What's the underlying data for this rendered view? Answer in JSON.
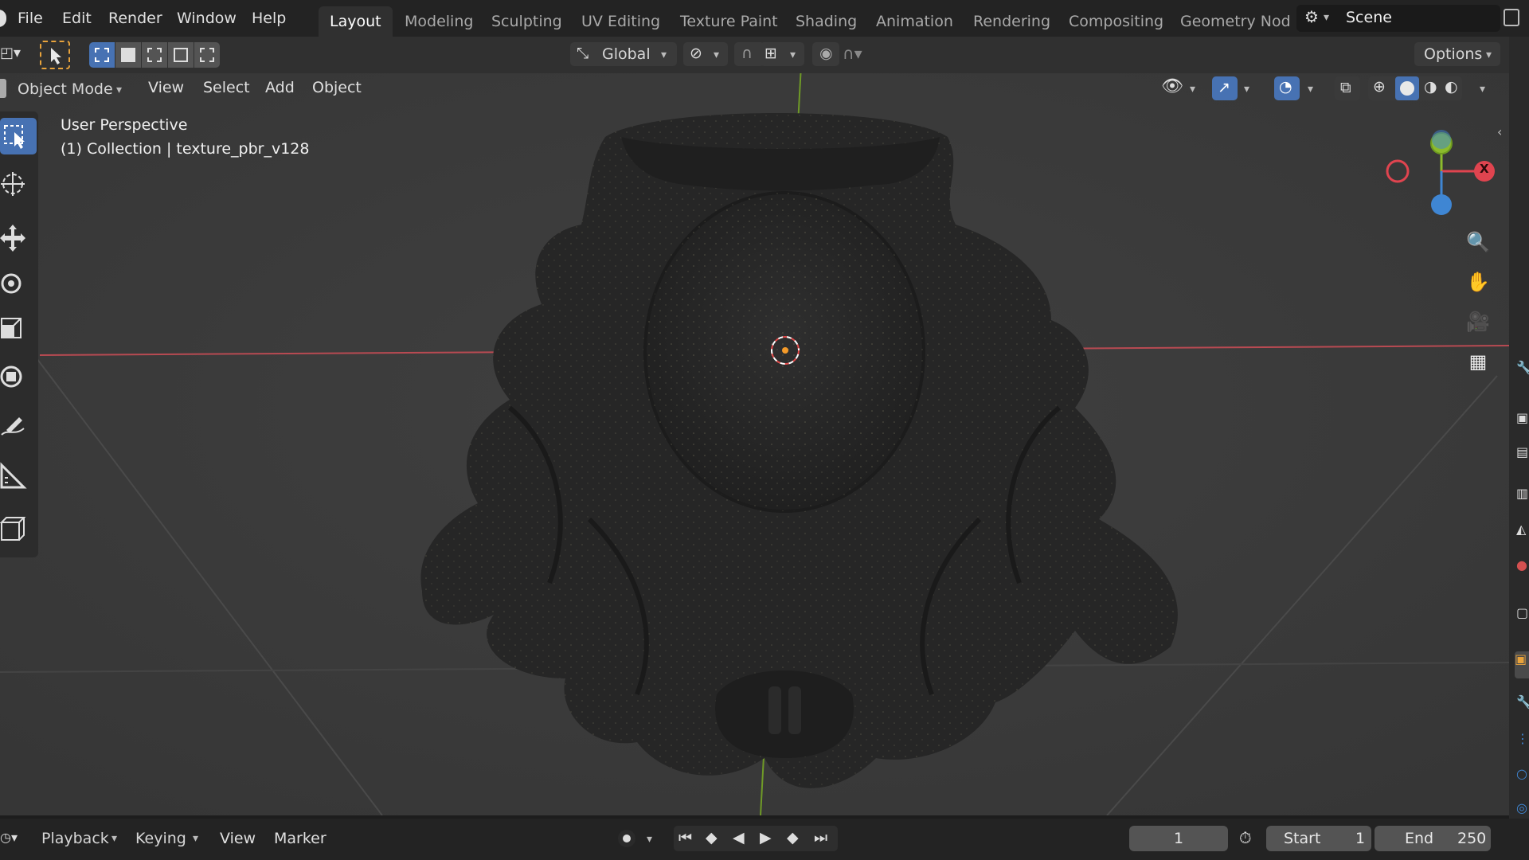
{
  "menu": {
    "file": "File",
    "edit": "Edit",
    "render": "Render",
    "window": "Window",
    "help": "Help"
  },
  "workspaces": [
    "Layout",
    "Modeling",
    "Sculpting",
    "UV Editing",
    "Texture Paint",
    "Shading",
    "Animation",
    "Rendering",
    "Compositing",
    "Geometry Nod"
  ],
  "scene": {
    "label": "Scene"
  },
  "toolbar": {
    "orientation": "Global",
    "options": "Options"
  },
  "view_header": {
    "mode": "Object Mode",
    "view": "View",
    "select": "Select",
    "add": "Add",
    "object": "Object"
  },
  "overlay": {
    "perspective": "User Perspective",
    "collection": "(1) Collection | texture_pbr_v128"
  },
  "gizmo": {
    "x_label": "X"
  },
  "timeline": {
    "playback": "Playback",
    "keying": "Keying",
    "view": "View",
    "marker": "Marker",
    "current_frame": "1",
    "start_label": "Start",
    "start_value": "1",
    "end_label": "End",
    "end_value": "250"
  },
  "icons": [
    "blender-icon",
    "select-box-icon",
    "cursor-icon",
    "move-icon",
    "rotate-icon",
    "scale-icon",
    "transform-icon",
    "annotate-icon",
    "measure-icon",
    "add-cube-icon",
    "zoom-icon",
    "hand-icon",
    "camera-icon",
    "grid-icon",
    "play-icon"
  ],
  "colors": {
    "accent": "#4772b3",
    "x_axis": "#e0444f",
    "y_axis": "#8cbb2c",
    "z_axis": "#3f86d3",
    "viewport_bg": "#3b3b3b"
  }
}
